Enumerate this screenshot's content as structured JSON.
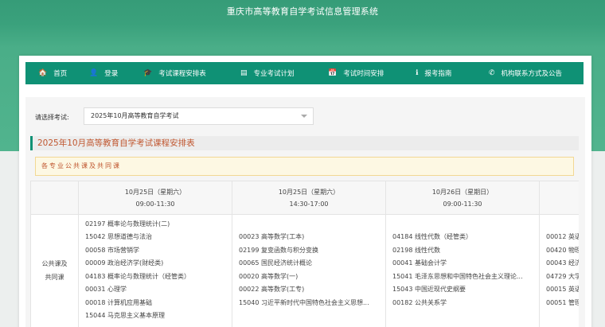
{
  "site_title": "重庆市高等教育自学考试信息管理系统",
  "nav": [
    {
      "label": "首页",
      "icon": "home-icon",
      "glyph": "🏠"
    },
    {
      "label": "登录",
      "icon": "user-icon",
      "glyph": "👤"
    },
    {
      "label": "考试课程安排表",
      "icon": "graduation-cap-icon",
      "glyph": "🎓"
    },
    {
      "label": "专业考试计划",
      "icon": "id-card-icon",
      "glyph": "▤"
    },
    {
      "label": "考试时间安排",
      "icon": "calendar-icon",
      "glyph": "📅"
    },
    {
      "label": "报考指南",
      "icon": "info-icon",
      "glyph": "ℹ"
    },
    {
      "label": "机构联系方式及公告",
      "icon": "phone-icon",
      "glyph": "✆"
    }
  ],
  "exam_select": {
    "label": "请选择考试:",
    "value": "2025年10月高等教育自学考试"
  },
  "section_title": "2025年10月高等教育自学考试课程安排表",
  "notice": "各专业公共课及共同课",
  "category": {
    "line1": "公共课及",
    "line2": "共同课"
  },
  "sessions": [
    {
      "date": "10月25日（星期六）",
      "time": "09:00-11:30",
      "courses": [
        "02197 概率论与数理统计(二)",
        "15042 思想道德与法治",
        "00058 市场营销学",
        "00009 政治经济学(财经类)",
        "04183 概率论与数理统计（经管类）",
        "00031 心理学",
        "00018 计算机应用基础",
        "15044 马克思主义基本原理"
      ]
    },
    {
      "date": "10月25日（星期六）",
      "time": "14:30-17:00",
      "courses": [
        "00023 高等数学(工本)",
        "02199 复变函数与积分变换",
        "00065 国民经济统计概论",
        "00020 高等数学(一)",
        "00022 高等数学(工专)",
        "15040 习近平新时代中国特色社会主义思想..."
      ]
    },
    {
      "date": "10月26日（星期日）",
      "time": "09:00-11:30",
      "courses": [
        "04184 线性代数（经管类）",
        "02198 线性代数",
        "00041 基础会计学",
        "15041 毛泽东思想和中国特色社会主义理论...",
        "15043 中国近现代史纲要",
        "00182 公共关系学"
      ]
    },
    {
      "date": "",
      "time": "",
      "courses": [
        "00012 英语",
        "00420 物理",
        "00043 经济",
        "04729 大学",
        "00015 英语",
        "00051 管理"
      ]
    }
  ]
}
